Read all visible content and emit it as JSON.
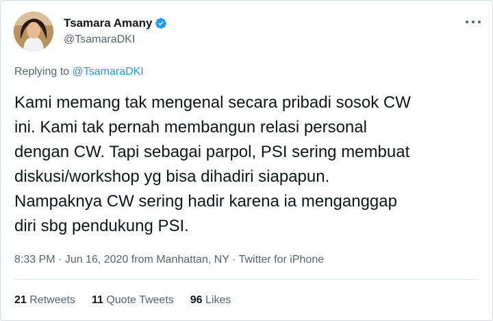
{
  "author": {
    "name": "Tsamara Amany",
    "handle": "@TsamaraDKI",
    "verified_icon": "verified-badge-icon",
    "verified_color": "#1d9bf0"
  },
  "more_icon": "more-options-icon",
  "reply": {
    "prefix": "Replying to",
    "mention": "@TsamaraDKI"
  },
  "tweet": {
    "text": "Kami memang tak mengenal secara pribadi sosok CW\nini. Kami tak pernah membangun relasi personal\ndengan CW. Tapi sebagai parpol, PSI sering membuat\ndiskusi/workshop yg bisa dihadiri siapapun.\nNampaknya CW sering hadir karena ia menganggap\ndiri sbg pendukung PSI."
  },
  "meta": {
    "time": "8:33 PM",
    "sep1": " · ",
    "date": "Jun 16, 2020 from Manhattan, NY",
    "sep2": " · ",
    "source": "Twitter for iPhone"
  },
  "stats": [
    {
      "num": "21",
      "label": "Retweets"
    },
    {
      "num": "11",
      "label": "Quote Tweets"
    },
    {
      "num": "96",
      "label": "Likes"
    }
  ],
  "colors": {
    "link": "#1d9bf0",
    "secondary_text": "#536471",
    "primary_text": "#0f1419"
  }
}
